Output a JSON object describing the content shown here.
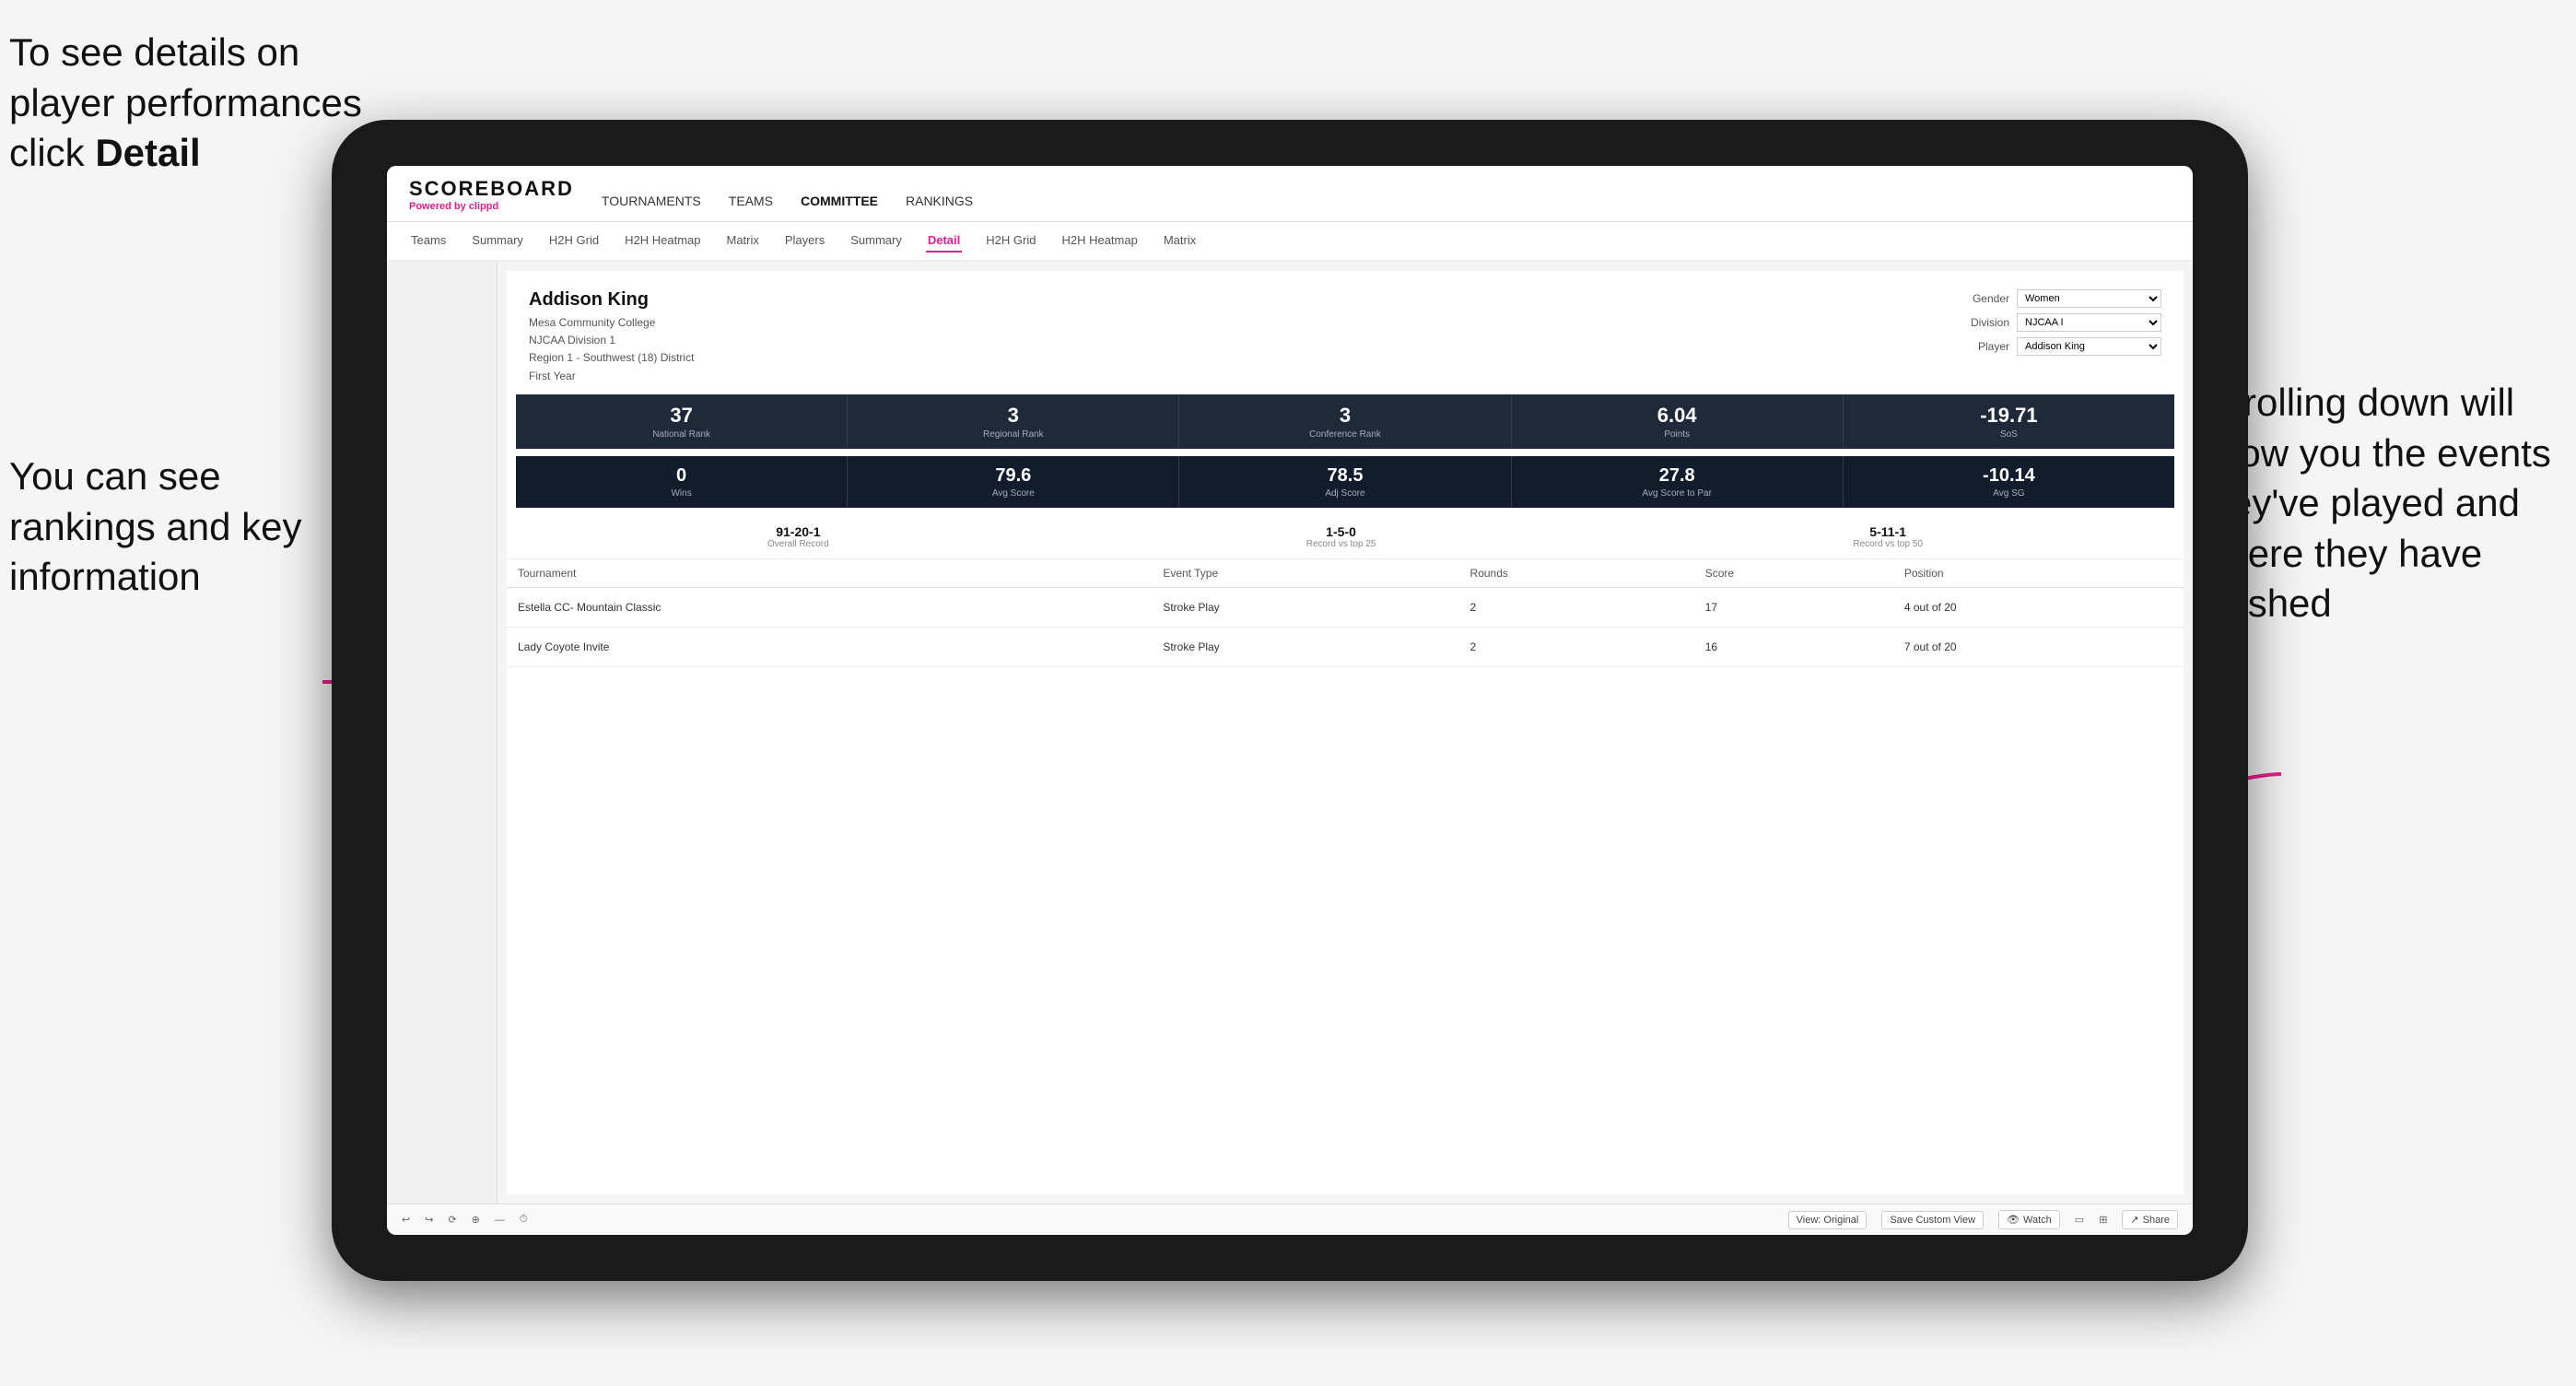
{
  "annotations": {
    "top_left": "To see details on player performances click",
    "top_left_bold": "Detail",
    "bottom_left_line1": "You can see",
    "bottom_left_line2": "rankings and",
    "bottom_left_line3": "key information",
    "right_line1": "Scrolling down",
    "right_line2": "will show you",
    "right_line3": "the events",
    "right_line4": "they've played",
    "right_line5": "and where they",
    "right_line6": "have finished"
  },
  "nav": {
    "logo": "SCOREBOARD",
    "powered_by": "Powered by",
    "brand": "clippd",
    "main_items": [
      "TOURNAMENTS",
      "TEAMS",
      "COMMITTEE",
      "RANKINGS"
    ],
    "sub_items": [
      "Teams",
      "Summary",
      "H2H Grid",
      "H2H Heatmap",
      "Matrix",
      "Players",
      "Summary",
      "Detail",
      "H2H Grid",
      "H2H Heatmap",
      "Matrix"
    ],
    "active_sub": "Detail"
  },
  "player": {
    "name": "Addison King",
    "school": "Mesa Community College",
    "division": "NJCAA Division 1",
    "region": "Region 1 - Southwest (18) District",
    "year": "First Year",
    "gender_label": "Gender",
    "gender_value": "Women",
    "division_label": "Division",
    "division_value": "NJCAA I",
    "player_label": "Player",
    "player_value": "Addison King"
  },
  "stats_row1": [
    {
      "value": "37",
      "label": "National Rank"
    },
    {
      "value": "3",
      "label": "Regional Rank"
    },
    {
      "value": "3",
      "label": "Conference Rank"
    },
    {
      "value": "6.04",
      "label": "Points"
    },
    {
      "value": "-19.71",
      "label": "SoS"
    }
  ],
  "stats_row2": [
    {
      "value": "0",
      "label": "Wins"
    },
    {
      "value": "79.6",
      "label": "Avg Score"
    },
    {
      "value": "78.5",
      "label": "Adj Score"
    },
    {
      "value": "27.8",
      "label": "Avg Score to Par"
    },
    {
      "value": "-10.14",
      "label": "Avg SG"
    }
  ],
  "records": [
    {
      "value": "91-20-1",
      "label": "Overall Record"
    },
    {
      "value": "1-5-0",
      "label": "Record vs top 25"
    },
    {
      "value": "5-11-1",
      "label": "Record vs top 50"
    }
  ],
  "table": {
    "headers": [
      "Tournament",
      "Event Type",
      "Rounds",
      "Score",
      "Position"
    ],
    "rows": [
      {
        "tournament": "Estella CC- Mountain Classic",
        "event_type": "Stroke Play",
        "rounds": "2",
        "score": "17",
        "position": "4 out of 20"
      },
      {
        "tournament": "Lady Coyote Invite",
        "event_type": "Stroke Play",
        "rounds": "2",
        "score": "16",
        "position": "7 out of 20"
      }
    ]
  },
  "toolbar": {
    "view_original": "View: Original",
    "save_custom": "Save Custom View",
    "watch": "Watch",
    "share": "Share"
  }
}
